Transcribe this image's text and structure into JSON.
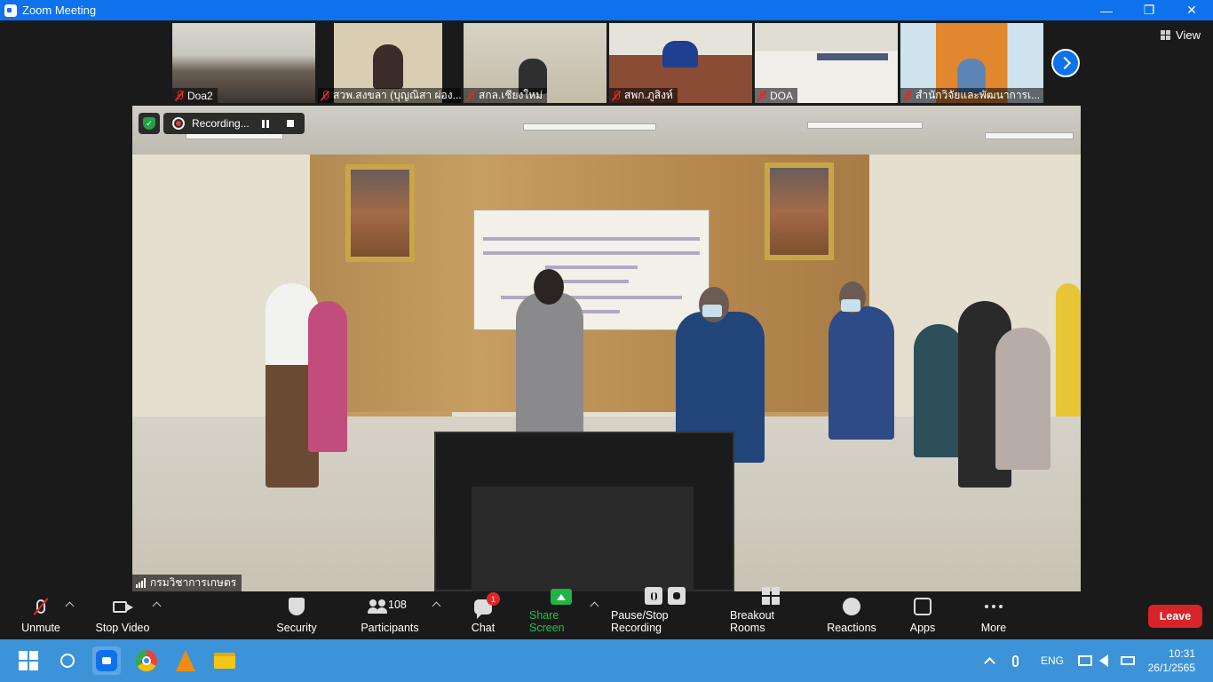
{
  "window": {
    "title": "Zoom Meeting",
    "minimize_glyph": "—",
    "restore_glyph": "❐",
    "close_glyph": "✕"
  },
  "view_button": {
    "label": "View"
  },
  "thumbnails": [
    {
      "name": "Doa2"
    },
    {
      "name": "สวพ.สงขลา (บุญณิสา ผ่อง..."
    },
    {
      "name": "สกล.เชียงใหม่"
    },
    {
      "name": "สพก.ภูสิงห์"
    },
    {
      "name": "DOA"
    },
    {
      "name": "สำนักวิจัยและพัฒนาการเ..."
    }
  ],
  "recording": {
    "label": "Recording..."
  },
  "shield_check": "✓",
  "main_speaker": {
    "name": "กรมวิชาการเกษตร"
  },
  "toolbar": {
    "unmute": "Unmute",
    "stop_video": "Stop Video",
    "security": "Security",
    "participants": "Participants",
    "participants_count": "108",
    "chat": "Chat",
    "chat_badge": "1",
    "share_screen": "Share Screen",
    "pause_stop_recording": "Pause/Stop Recording",
    "breakout_rooms": "Breakout Rooms",
    "reactions": "Reactions",
    "apps": "Apps",
    "more": "More",
    "leave": "Leave"
  },
  "taskbar": {
    "language": "ENG",
    "time": "10:31",
    "date": "26/1/2565"
  },
  "colors": {
    "zoom_blue": "#0e72ed",
    "leave_red": "#d8232a",
    "share_green": "#20b445",
    "taskbar_blue": "#3c93d8"
  }
}
